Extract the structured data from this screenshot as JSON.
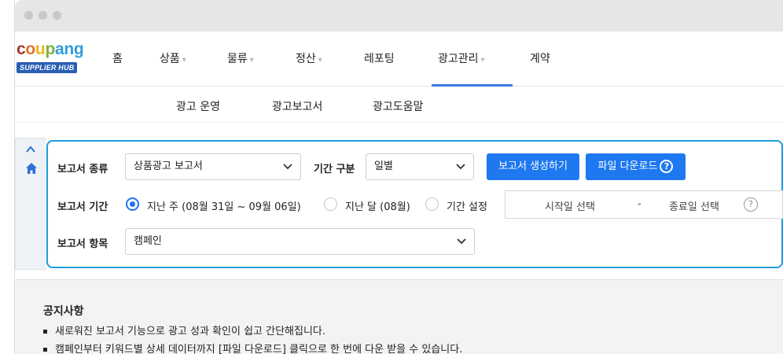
{
  "brand": {
    "word": [
      {
        "t": "c",
        "color": "#a23a2e"
      },
      {
        "t": "o",
        "color": "#e0762c"
      },
      {
        "t": "u",
        "color": "#f1b21a"
      },
      {
        "t": "p",
        "color": "#7cb042"
      },
      {
        "t": "a",
        "color": "#2f9ed9"
      },
      {
        "t": "n",
        "color": "#2f9ed9"
      },
      {
        "t": "g",
        "color": "#2f9ed9"
      }
    ],
    "badge": "SUPPLIER HUB"
  },
  "nav": {
    "items": [
      {
        "label": "홈",
        "has_dropdown": false
      },
      {
        "label": "상품",
        "has_dropdown": true
      },
      {
        "label": "물류",
        "has_dropdown": true
      },
      {
        "label": "정산",
        "has_dropdown": true
      },
      {
        "label": "레포팅",
        "has_dropdown": false
      },
      {
        "label": "광고관리",
        "has_dropdown": true,
        "active": true
      },
      {
        "label": "계약",
        "has_dropdown": false
      }
    ],
    "chevron": "▾"
  },
  "subnav": {
    "items": [
      "광고 운영",
      "광고보고서",
      "광고도움말"
    ]
  },
  "form": {
    "report_type": {
      "label": "보고서 종류",
      "value": "상품광고 보고서"
    },
    "period_type": {
      "label": "기간 구분",
      "value": "일별"
    },
    "create_button": "보고서 생성하기",
    "download_button": "파일 다운로드",
    "download_help_glyph": "?",
    "period": {
      "label": "보고서 기간",
      "options": [
        {
          "label": "지난 주 (08월 31일 ~ 09월 06일)",
          "checked": true
        },
        {
          "label": "지난 달 (08월)",
          "checked": false
        },
        {
          "label": "기간 설정",
          "checked": false
        }
      ],
      "start_placeholder": "시작일 선택",
      "separator": "-",
      "end_placeholder": "종료일 선택",
      "help_glyph": "?"
    },
    "report_items": {
      "label": "보고서 항목",
      "value": "캠페인"
    }
  },
  "notice": {
    "title": "공지사항",
    "items": [
      "새로워진 보고서 기능으로 광고 성과 확인이 쉽고 간단해집니다.",
      "캠페인부터 키워드별 상세 데이터까지 [파일 다운로드] 클릭으로 한 번에 다운 받을 수 있습니다."
    ]
  },
  "colors": {
    "accent": "#1e78f0",
    "panel_border": "#1f9de0",
    "nav_active": "#3e7ce6"
  }
}
